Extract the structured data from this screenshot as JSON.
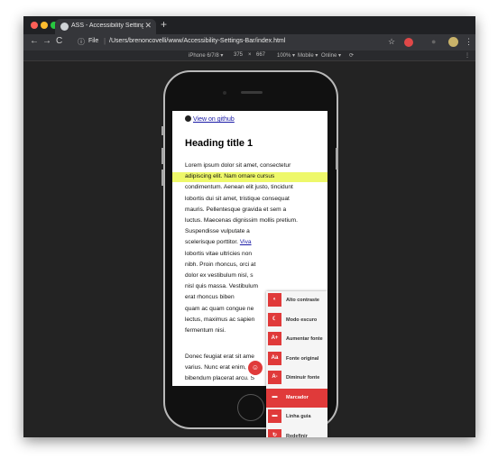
{
  "browser": {
    "tab_title": "ASS - Accessibility Settings Ba",
    "tab_close": "✕",
    "new_tab": "+",
    "nav_back": "←",
    "nav_forward": "→",
    "nav_reload": "C",
    "address_info": "ⓘ",
    "address_scheme": "File",
    "address_sep": "|",
    "address_url": "/Users/brenoncovelli/www/Accessibility-Settings-Bar/index.html",
    "star_icon": "☆",
    "menu_icon": "⋮"
  },
  "devtools": {
    "device": "iPhone 6/7/8 ▾",
    "width": "375",
    "times": "×",
    "height": "667",
    "zoom": "100% ▾",
    "mode": "Mobile ▾",
    "network": "Online ▾",
    "rotate_icon": "⟳",
    "menu_icon": "⋮"
  },
  "page": {
    "github_link": "View on github",
    "heading": "Heading title 1",
    "para1_lines": [
      "Lorem ipsum dolor sit amet, consectetur",
      "adipiscing elit. Nam ornare cursus",
      "condimentum. Aenean elit justo, tincidunt",
      "lobortis dui sit amet, tristique consequat",
      "mauris. Pellentesque gravida et sem a",
      "luctus. Maecenas dignissim mollis pretium.",
      "Suspendisse vulputate a",
      "scelerisque porttitor. Viva",
      "lobortis vitae ultricies non",
      "nibh. Proin rhoncus, orci at",
      "dolor ex vestibulum nisl, s",
      "nisl quis massa. Vestibulum",
      "erat rhoncus biben",
      "quam ac quam congue ne",
      "lectus, maximus ac sapien",
      "fermentum nisi."
    ],
    "para2_lines": [
      "Donec feugiat erat sit ame",
      "varius. Nunc erat enim, ult",
      "bibendum placerat arcu. S"
    ]
  },
  "a11y": {
    "toggle_icon": "☺",
    "items": [
      {
        "icon": "◐",
        "label": "Alto contraste"
      },
      {
        "icon": "☾",
        "label": "Modo escuro"
      },
      {
        "icon": "A+",
        "label": "Aumentar fonte"
      },
      {
        "icon": "Aa",
        "label": "Fonte original"
      },
      {
        "icon": "A-",
        "label": "Diminuir fonte"
      },
      {
        "icon": "▬",
        "label": "Marcador"
      },
      {
        "icon": "▬",
        "label": "Linha guia"
      },
      {
        "icon": "↻",
        "label": "Redefinir"
      }
    ]
  },
  "colors": {
    "accent": "#e03a3a",
    "highlight": "#eef86a"
  }
}
